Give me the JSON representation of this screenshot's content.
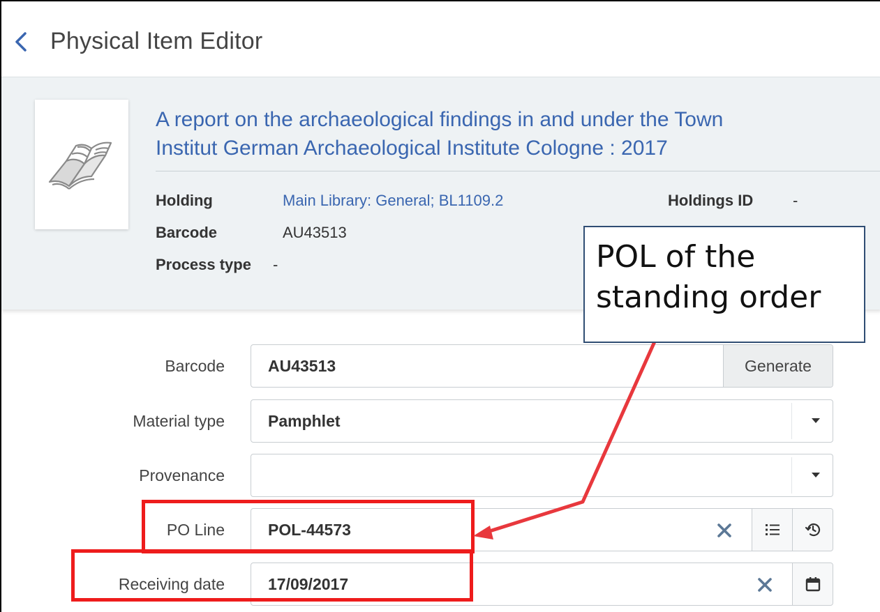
{
  "header": {
    "title": "Physical Item Editor",
    "back_icon": "chevron-left-icon"
  },
  "record": {
    "thumbnail_icon": "open-book-icon",
    "title_line1": "A report on the archaeological findings in and under the Town",
    "title_line2": "Institut German Archaeological Institute Cologne : 2017",
    "holding_label": "Holding",
    "holding_value": "Main Library: General; BL1109.2",
    "barcode_label": "Barcode",
    "barcode_value": "AU43513",
    "process_type_label": "Process type",
    "process_type_value": "-",
    "holdings_id_label": "Holdings ID",
    "holdings_id_value": "-"
  },
  "form": {
    "barcode": {
      "label": "Barcode",
      "value": "AU43513",
      "button": "Generate"
    },
    "material_type": {
      "label": "Material type",
      "value": "Pamphlet"
    },
    "provenance": {
      "label": "Provenance",
      "value": ""
    },
    "po_line": {
      "label": "PO Line",
      "value": "POL-44573",
      "icons": [
        "clear-icon",
        "list-icon",
        "history-icon"
      ]
    },
    "receiving_date": {
      "label": "Receiving date",
      "value": "17/09/2017",
      "icons": [
        "clear-icon",
        "calendar-icon"
      ]
    }
  },
  "annotation": {
    "callout_line1": "POL of the",
    "callout_line2": "standing order",
    "highlight_color": "#ee1c1c",
    "arrow_color": "#e8383d"
  },
  "colors": {
    "link": "#3a66b0",
    "summary_bg": "#eef2f4",
    "icon_blue": "#5c7896"
  }
}
